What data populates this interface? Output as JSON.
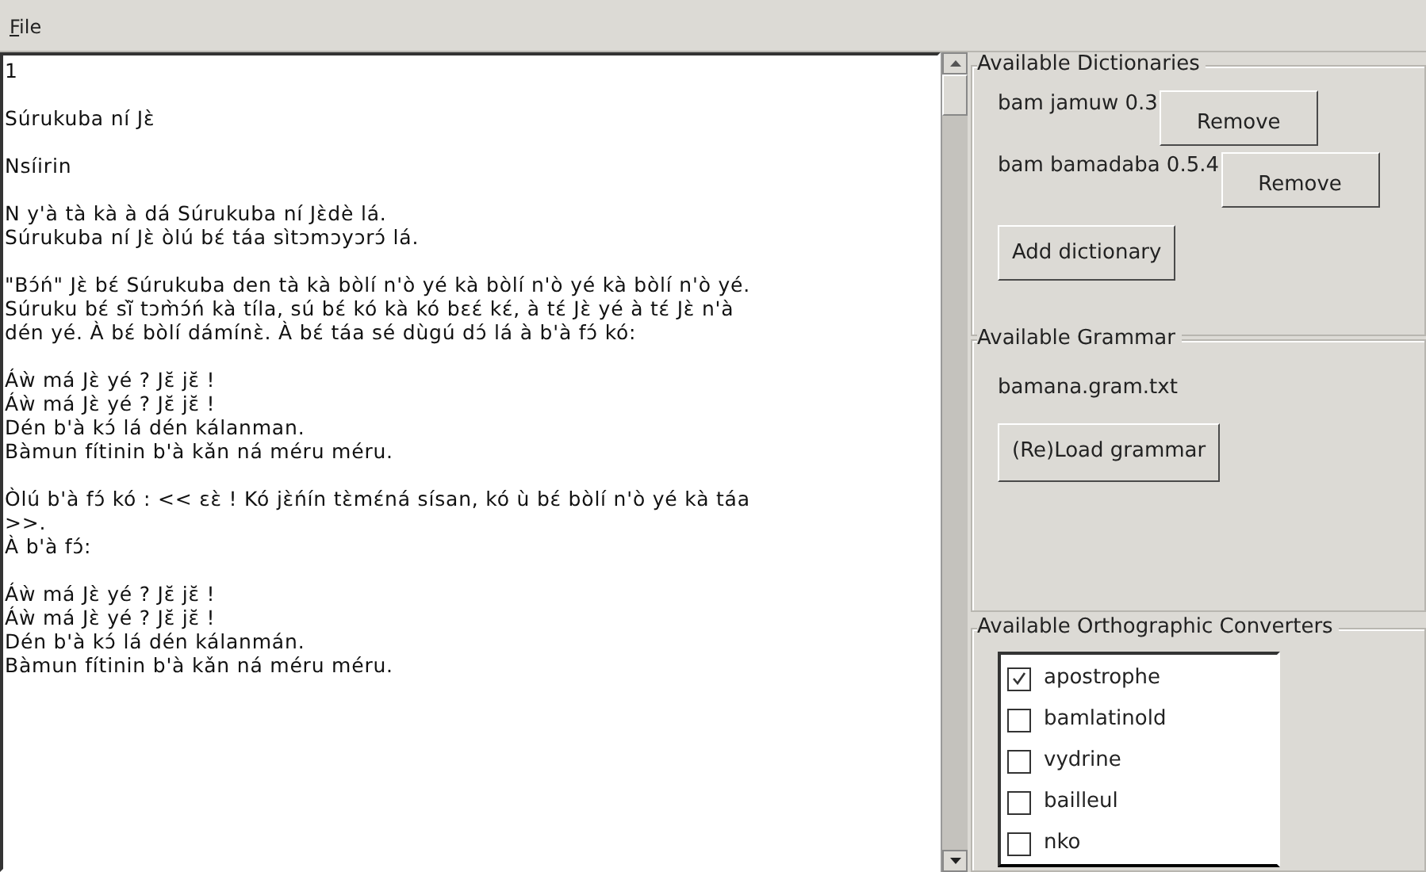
{
  "menu": [
    "File"
  ],
  "editor": {
    "paragraphs": [
      [
        "1"
      ],
      [
        "Súrukuba ní Jɛ̀"
      ],
      [
        "Nsíirin"
      ],
      [
        "N y'à tà kà à dá Súrukuba ní Jɛ̀dè lá.",
        "Súrukuba ní Jɛ̀ òlú bɛ́ táa sìtɔmɔyɔrɔ́ lá."
      ],
      [
        "\"Bɔ́ń\" Jɛ̀ bɛ́ Súrukuba den tà kà bòlí n'ò yé kà bòlí n'ò yé kà bòlí n'ò yé.",
        "Súruku bɛ́ sĩ̀ tɔm̀ɔ́ń kà tíla, sú bɛ́ kó kà kó bɛɛ́ kɛ́, à tɛ́ Jɛ̀ yé à tɛ́ Jɛ̀ n'à",
        "dén yé. À bɛ́ bòlí dámínɛ̀. À bɛ́ táa sé dùgú dɔ́ lá à b'à fɔ́ kó:"
      ],
      [
        "Áẁ má Jɛ̀ yé ? Jɛ̆ jɛ̆ !",
        "Áẁ má Jɛ̀ yé ? Jɛ̆ jɛ̆ !",
        "Dén b'à kɔ́ lá dén kálanman.",
        "Bàmun fítinin b'à kǎn ná méru méru."
      ],
      [
        "Òlú b'à fɔ́ kó : << ɛɛ̀ ! Kó jɛ̀ńín tɛ̀mɛ́ná sísan, kó ù bɛ́ bòlí n'ò yé kà táa",
        ">>.",
        "À b'à fɔ́:"
      ],
      [
        "Áẁ má Jɛ̀ yé ? Jɛ̆ jɛ̆ !",
        "Áẁ má Jɛ̀ yé ? Jɛ̆ jɛ̆ !",
        "Dén b'à kɔ́ lá dén kálanmán.",
        "Bàmun fítinin b'à kǎn ná méru méru."
      ]
    ]
  },
  "dictionaries": {
    "title": "Available Dictionaries",
    "items": [
      {
        "name": "bam jamuw 0.3",
        "button": "Remove"
      },
      {
        "name": "bam bamadaba 0.5.4",
        "button": "Remove"
      }
    ],
    "add_button": "Add dictionary"
  },
  "grammar": {
    "title": "Available Grammar",
    "file": "bamana.gram.txt",
    "button": "(Re)Load grammar"
  },
  "converters": {
    "title": "Available Orthographic Converters",
    "items": [
      {
        "label": "apostrophe",
        "checked": true
      },
      {
        "label": "bamlatinold",
        "checked": false
      },
      {
        "label": "vydrine",
        "checked": false
      },
      {
        "label": "bailleul",
        "checked": false
      },
      {
        "label": "nko",
        "checked": false
      }
    ]
  }
}
